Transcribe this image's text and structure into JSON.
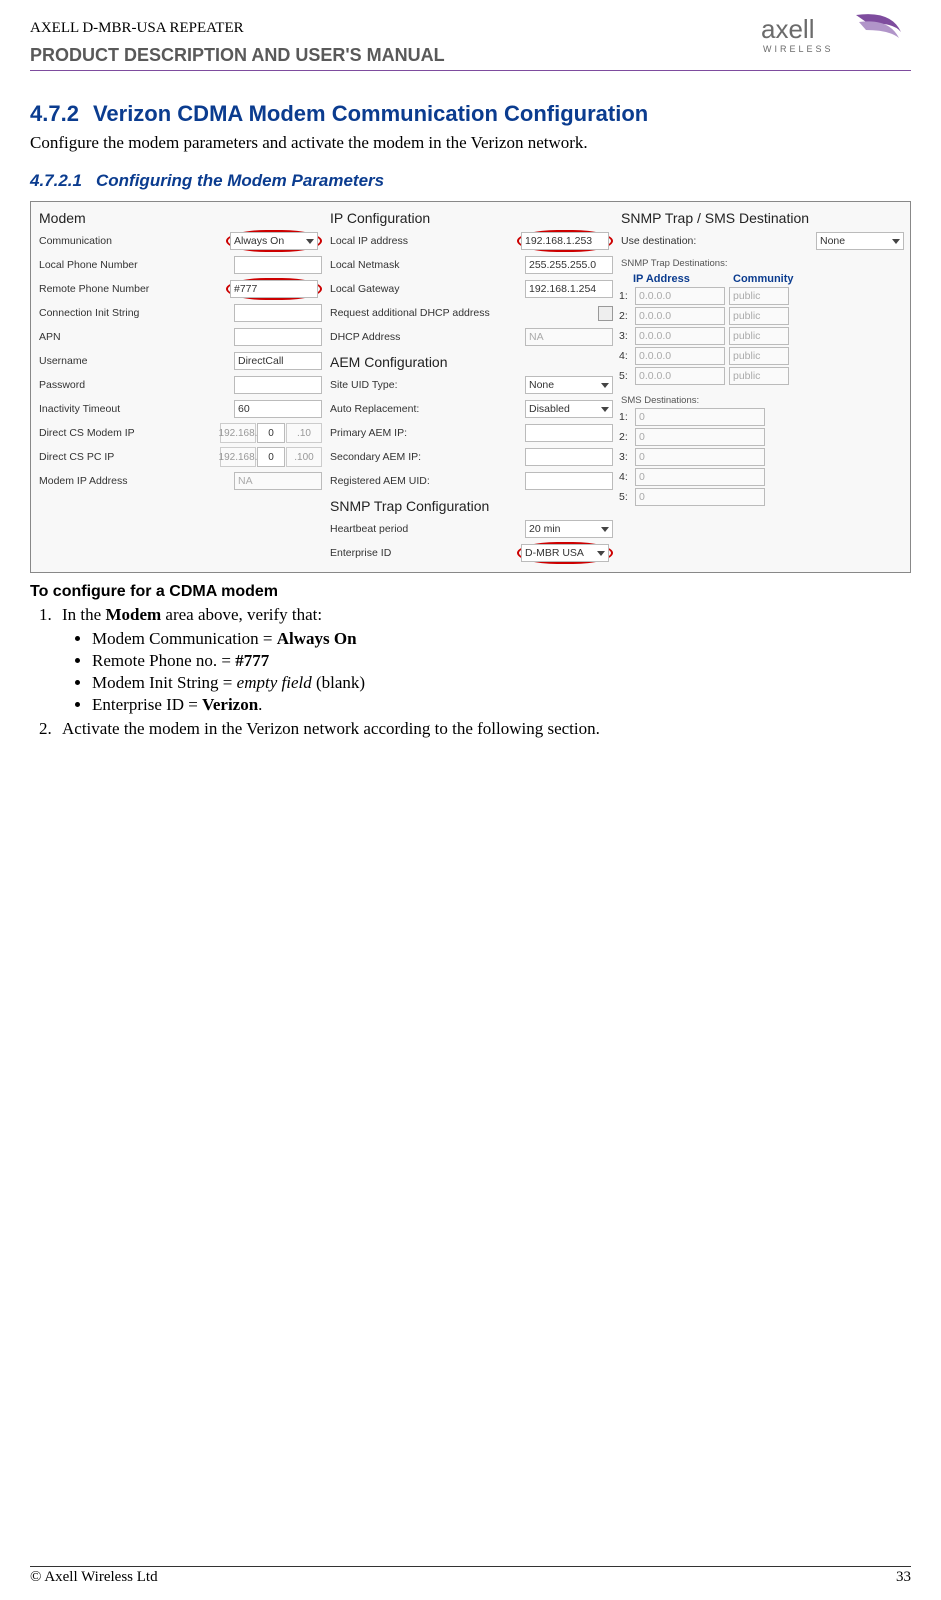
{
  "header": {
    "top": "AXELL D-MBR-USA REPEATER",
    "sub": "PRODUCT DESCRIPTION AND USER'S MANUAL",
    "logo_text_top": "axell",
    "logo_text_bottom": "WIRELESS"
  },
  "section": {
    "num": "4.7.2",
    "title": "Verizon CDMA Modem Communication Configuration",
    "intro": "Configure the modem parameters and activate the modem in the Verizon  network."
  },
  "subsection": {
    "num": "4.7.2.1",
    "title": "Configuring the Modem Parameters"
  },
  "ui": {
    "modem": {
      "title": "Modem",
      "communication_lbl": "Communication",
      "communication_val": "Always On",
      "local_phone_lbl": "Local Phone Number",
      "local_phone_val": "",
      "remote_phone_lbl": "Remote Phone Number",
      "remote_phone_val": "#777",
      "conn_init_lbl": "Connection Init String",
      "conn_init_val": "",
      "apn_lbl": "APN",
      "apn_val": "",
      "username_lbl": "Username",
      "username_val": "DirectCall",
      "password_lbl": "Password",
      "password_val": "",
      "inactivity_lbl": "Inactivity Timeout",
      "inactivity_val": "60",
      "direct_cs_modem_lbl": "Direct CS Modem IP",
      "direct_cs_modem_a": "192.168.",
      "direct_cs_modem_b": "0",
      "direct_cs_modem_c": ".10",
      "direct_cs_pc_lbl": "Direct CS PC IP",
      "direct_cs_pc_a": "192.168.",
      "direct_cs_pc_b": "0",
      "direct_cs_pc_c": ".100",
      "modem_ip_lbl": "Modem IP Address",
      "modem_ip_val": "NA"
    },
    "ipcfg": {
      "title": "IP Configuration",
      "local_ip_lbl": "Local IP address",
      "local_ip_val": "192.168.1.253",
      "netmask_lbl": "Local Netmask",
      "netmask_val": "255.255.255.0",
      "gateway_lbl": "Local Gateway",
      "gateway_val": "192.168.1.254",
      "req_dhcp_lbl": "Request additional DHCP address",
      "dhcp_addr_lbl": "DHCP Address",
      "dhcp_addr_val": "NA"
    },
    "aem": {
      "title": "AEM Configuration",
      "site_uid_lbl": "Site UID Type:",
      "site_uid_val": "None",
      "auto_repl_lbl": "Auto Replacement:",
      "auto_repl_val": "Disabled",
      "primary_lbl": "Primary AEM IP:",
      "primary_val": "",
      "secondary_lbl": "Secondary AEM IP:",
      "secondary_val": "",
      "reg_uid_lbl": "Registered AEM UID:",
      "reg_uid_val": ""
    },
    "snmp": {
      "title": "SNMP Trap Configuration",
      "heartbeat_lbl": "Heartbeat period",
      "heartbeat_val": "20 min",
      "enterprise_lbl": "Enterprise ID",
      "enterprise_val": "D-MBR USA"
    },
    "dest": {
      "title": "SNMP Trap / SMS Destination",
      "use_dest_lbl": "Use destination:",
      "use_dest_val": "None",
      "trap_label": "SNMP Trap Destinations:",
      "col_ip": "IP Address",
      "col_com": "Community",
      "traps": [
        {
          "n": "1:",
          "ip": "0.0.0.0",
          "com": "public"
        },
        {
          "n": "2:",
          "ip": "0.0.0.0",
          "com": "public"
        },
        {
          "n": "3:",
          "ip": "0.0.0.0",
          "com": "public"
        },
        {
          "n": "4:",
          "ip": "0.0.0.0",
          "com": "public"
        },
        {
          "n": "5:",
          "ip": "0.0.0.0",
          "com": "public"
        }
      ],
      "sms_label": "SMS Destinations:",
      "sms": [
        {
          "n": "1:",
          "v": "0"
        },
        {
          "n": "2:",
          "v": "0"
        },
        {
          "n": "3:",
          "v": "0"
        },
        {
          "n": "4:",
          "v": "0"
        },
        {
          "n": "5:",
          "v": "0"
        }
      ]
    }
  },
  "instructions": {
    "heading": "To configure for a CDMA modem",
    "step1_pre": "In the ",
    "step1_bold": "Modem",
    "step1_post": " area above, verify that:",
    "b1_pre": "Modem Communication  = ",
    "b1_bold": "Always On",
    "b2_pre": "Remote Phone no. = ",
    "b2_bold": "#777",
    "b3_pre": "Modem Init String = ",
    "b3_em": "empty field",
    "b3_post": " (blank)",
    "b4_pre": "Enterprise ID = ",
    "b4_bold": "Verizon",
    "b4_post": ".",
    "step2": "Activate the modem in the Verizon network according to the following section."
  },
  "footer": {
    "left": "© Axell Wireless Ltd",
    "right": "33"
  }
}
